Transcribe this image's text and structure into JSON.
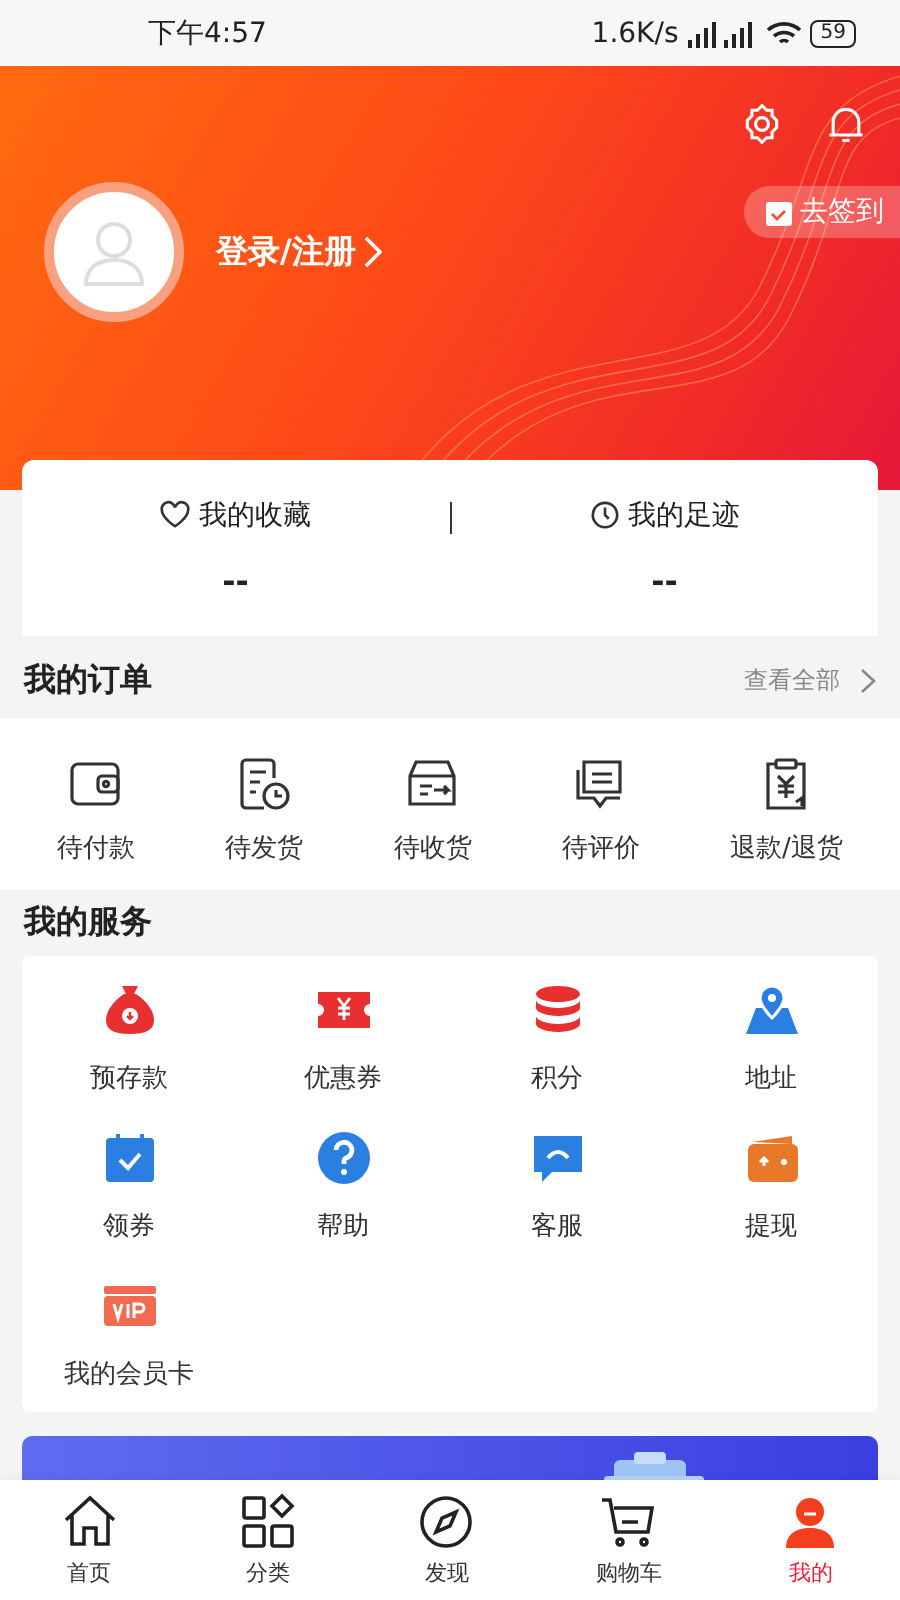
{
  "status_bar": {
    "time": "下午4:57",
    "net_speed": "1.6K/s",
    "battery": "59"
  },
  "profile": {
    "login_link": "登录/注册",
    "checkin_button": "去签到"
  },
  "stats": [
    {
      "label": "我的收藏",
      "value": "--"
    },
    {
      "label": "我的足迹",
      "value": "--"
    }
  ],
  "orders": {
    "title": "我的订单",
    "view_all": "查看全部",
    "items": [
      "待付款",
      "待发货",
      "待收货",
      "待评价",
      "退款/退货"
    ]
  },
  "services": {
    "title": "我的服务",
    "items": [
      "预存款",
      "优惠券",
      "积分",
      "地址",
      "领券",
      "帮助",
      "客服",
      "提现",
      "我的会员卡"
    ]
  },
  "tab_bar": [
    {
      "label": "首页",
      "selected": false
    },
    {
      "label": "分类",
      "selected": false
    },
    {
      "label": "发现",
      "selected": false
    },
    {
      "label": "购物车",
      "selected": false
    },
    {
      "label": "我的",
      "selected": true
    }
  ]
}
